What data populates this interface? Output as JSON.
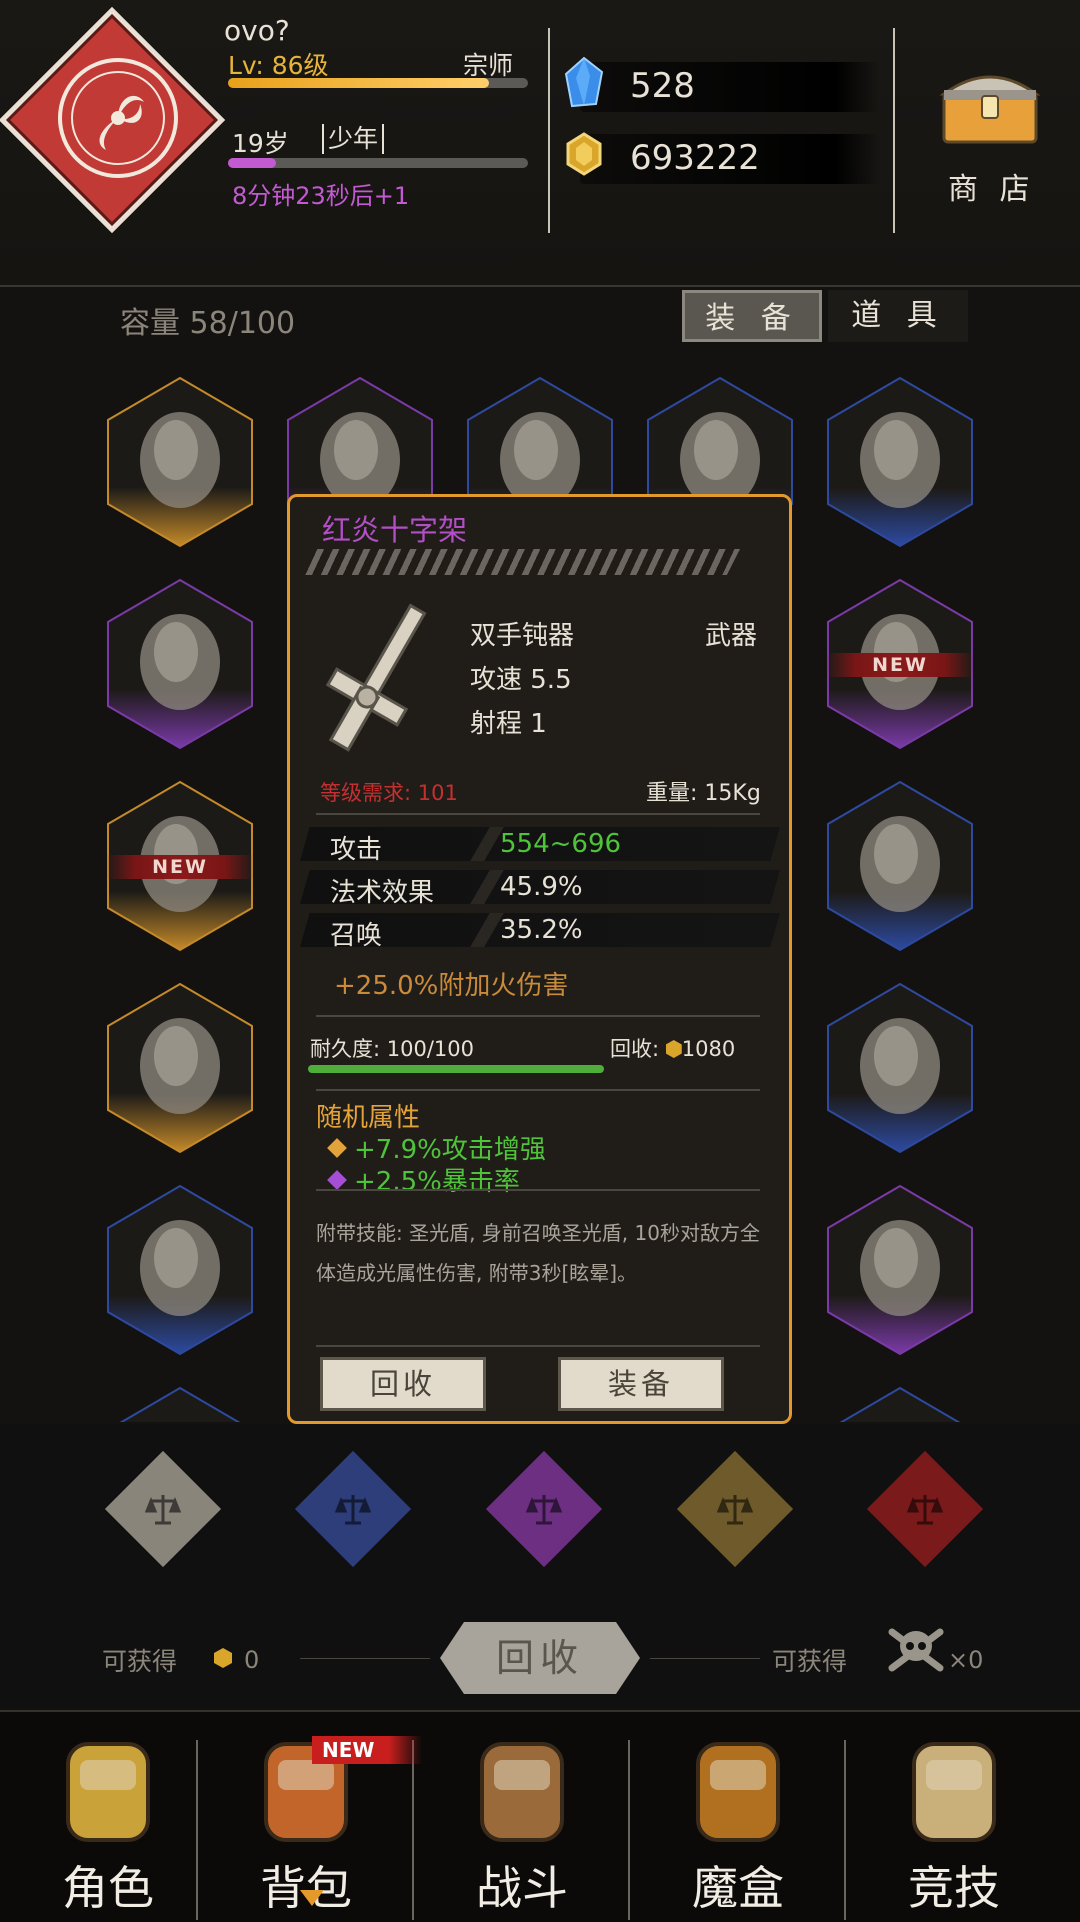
{
  "player": {
    "name": "ovo?",
    "level": "Lv: 86级",
    "rank": "宗师",
    "level_progress": 0.87,
    "age": "19岁",
    "stage": "少年",
    "age_progress": 0.16,
    "timer": "8分钟23秒后+1"
  },
  "currency": {
    "gems": "528",
    "coins": "693222"
  },
  "shop": {
    "label": "商 店",
    "icon": "treasure-chest-icon"
  },
  "inventory": {
    "capacity": "容量 58/100",
    "tabs": [
      "装 备",
      "道 具"
    ],
    "active_tab": "装 备",
    "new_label": "NEW"
  },
  "popup": {
    "name": "红炎十字架",
    "name_color": "#b24ec6",
    "weapon_type": "双手钝器",
    "category": "武器",
    "attack_speed": "攻速  5.5",
    "range": "射程  1",
    "level_req": "等级需求: 101",
    "weight": "重量: 15Kg",
    "stats": [
      {
        "name": "攻击",
        "value": "554~696",
        "color": "#4fc43a"
      },
      {
        "name": "法术效果",
        "value": "45.9%",
        "color": "#e8e2d6"
      },
      {
        "name": "召唤",
        "value": "35.2%",
        "color": "#e8e2d6"
      }
    ],
    "bonus": "+25.0%附加火伤害",
    "durability": "耐久度:  100/100",
    "durability_ratio": 1.0,
    "recycle_value": "回收:",
    "recycle_amount": "1080",
    "random_title": "随机属性",
    "random_attrs": [
      "+7.9%攻击增强",
      "+2.5%暴击率"
    ],
    "skill_desc": "附带技能: 圣光盾, 身前召唤圣光盾, 10秒对敌方全体造成光属性伤害, 附带3秒[眩晕]。",
    "btn_recycle": "回收",
    "btn_equip": "装备"
  },
  "quality_filters": [
    "#8a857b",
    "#2d3e7a",
    "#6d2f82",
    "#6e5a2a",
    "#7a1a1a"
  ],
  "recycle_bar": {
    "avail_left": "可获得",
    "avail_left_value": "0",
    "button": "回收",
    "avail_right": "可获得",
    "avail_right_value": "×0"
  },
  "nav": {
    "items": [
      {
        "label": "角色",
        "icon": "helmet-icon"
      },
      {
        "label": "背包",
        "icon": "backpack-icon"
      },
      {
        "label": "战斗",
        "icon": "sword-shield-icon"
      },
      {
        "label": "魔盒",
        "icon": "magic-box-icon"
      },
      {
        "label": "竞技",
        "icon": "tower-icon"
      }
    ],
    "active": "背包",
    "new_label": "NEW"
  }
}
